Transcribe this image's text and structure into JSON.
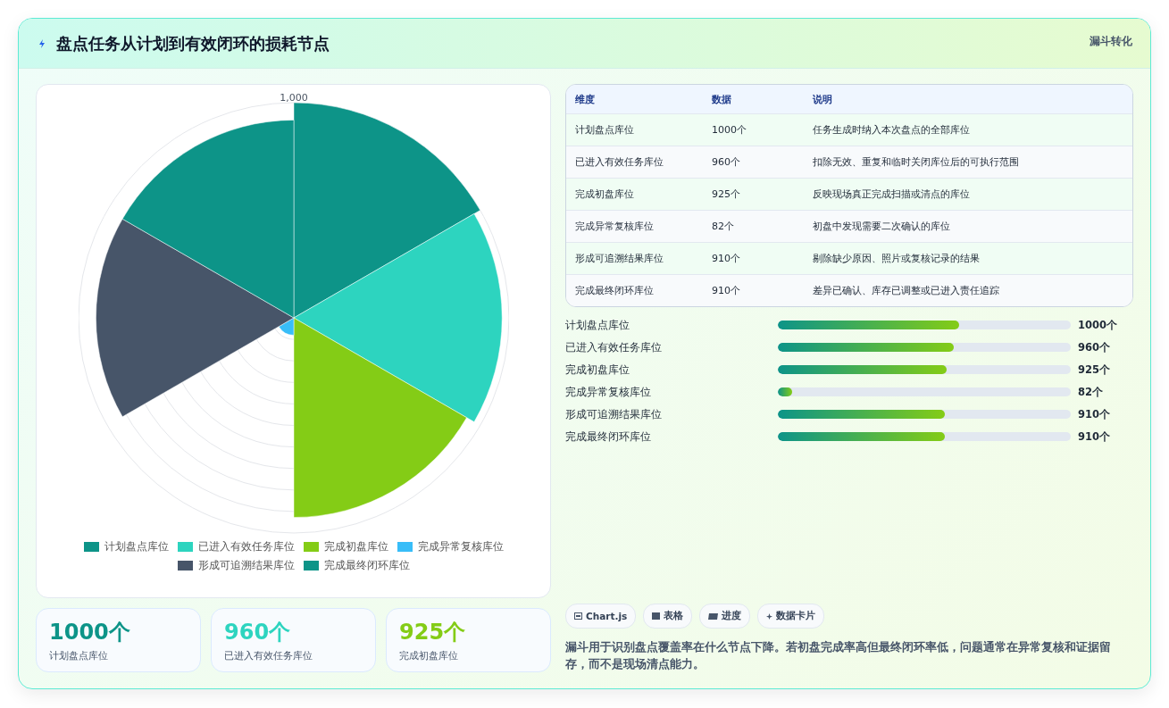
{
  "header": {
    "title": "盘点任务从计划到有效闭环的损耗节点",
    "badge": "漏斗转化"
  },
  "chart": {
    "scale_label": "1,000",
    "legend": [
      {
        "label": "计划盘点库位",
        "color": "#0d9488"
      },
      {
        "label": "已进入有效任务库位",
        "color": "#2dd4bf"
      },
      {
        "label": "完成初盘库位",
        "color": "#84cc16"
      },
      {
        "label": "完成异常复核库位",
        "color": "#38bdf8"
      },
      {
        "label": "形成可追溯结果库位",
        "color": "#475569"
      },
      {
        "label": "完成最终闭环库位",
        "color": "#0d9488"
      }
    ]
  },
  "stats": [
    {
      "value": "1000个",
      "label": "计划盘点库位",
      "color": "#0d9488"
    },
    {
      "value": "960个",
      "label": "已进入有效任务库位",
      "color": "#2dd4bf"
    },
    {
      "value": "925个",
      "label": "完成初盘库位",
      "color": "#84cc16"
    }
  ],
  "table": {
    "columns": [
      "维度",
      "数据",
      "说明"
    ],
    "rows": [
      [
        "计划盘点库位",
        "1000个",
        "任务生成时纳入本次盘点的全部库位"
      ],
      [
        "已进入有效任务库位",
        "960个",
        "扣除无效、重复和临时关闭库位后的可执行范围"
      ],
      [
        "完成初盘库位",
        "925个",
        "反映现场真正完成扫描或清点的库位"
      ],
      [
        "完成异常复核库位",
        "82个",
        "初盘中发现需要二次确认的库位"
      ],
      [
        "形成可追溯结果库位",
        "910个",
        "剔除缺少原因、照片或复核记录的结果"
      ],
      [
        "完成最终闭环库位",
        "910个",
        "差异已确认、库存已调整或已进入责任追踪"
      ]
    ]
  },
  "progress": [
    {
      "label": "计划盘点库位",
      "level": 0.62,
      "reading": "1000个"
    },
    {
      "label": "已进入有效任务库位",
      "level": 0.6,
      "reading": "960个"
    },
    {
      "label": "完成初盘库位",
      "level": 0.575,
      "reading": "925个"
    },
    {
      "label": "完成异常复核库位",
      "level": 0.05,
      "reading": "82个"
    },
    {
      "label": "形成可追溯结果库位",
      "level": 0.57,
      "reading": "910个"
    },
    {
      "label": "完成最终闭环库位",
      "level": 0.57,
      "reading": "910个"
    }
  ],
  "chips": [
    {
      "kind": "chart",
      "label": "Chart.js"
    },
    {
      "kind": "table",
      "label": "表格"
    },
    {
      "kind": "progress",
      "label": "进度"
    },
    {
      "kind": "card",
      "label": "数据卡片"
    }
  ],
  "note": "漏斗用于识别盘点覆盖率在什么节点下降。若初盘完成率高但最终闭环率低，问题通常在异常复核和证据留存，而不是现场清点能力。"
}
